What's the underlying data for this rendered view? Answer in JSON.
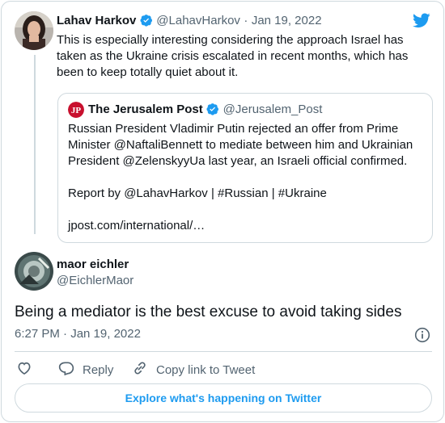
{
  "original_tweet": {
    "author_name": "Lahav Harkov",
    "handle": "@LahavHarkov",
    "separator": "·",
    "date": "Jan 19, 2022",
    "text": "This is especially interesting considering the approach Israel has taken as the Ukraine crisis escalated in recent months, which has been to keep totally quiet about it."
  },
  "quoted_tweet": {
    "author_name": "The Jerusalem Post",
    "handle": "@Jerusalem_Post",
    "paragraph1": "Russian President Vladimir Putin rejected an offer from Prime Minister @NaftaliBennett to mediate between him and Ukrainian President @ZelenskyyUa last year, an Israeli official confirmed.",
    "paragraph2": "Report by @LahavHarkov | #Russian | #Ukraine",
    "link": "jpost.com/international/…"
  },
  "reply_tweet": {
    "author_name": "maor eichler",
    "handle": "@EichlerMaor",
    "text": "Being a mediator is the best excuse to avoid taking sides",
    "timestamp": "6:27 PM · Jan 19, 2022"
  },
  "actions": {
    "reply_label": "Reply",
    "copy_link_label": "Copy link to Tweet"
  },
  "explore_label": "Explore what's happening on Twitter",
  "colors": {
    "twitter_blue": "#1d9bf0",
    "text_primary": "#0f1419",
    "text_secondary": "#536471",
    "border": "#cfd9de",
    "jpost_red": "#c8102e"
  },
  "icons": [
    "twitter-bird-icon",
    "verified-badge-icon",
    "info-icon",
    "heart-icon",
    "reply-icon",
    "link-icon"
  ]
}
